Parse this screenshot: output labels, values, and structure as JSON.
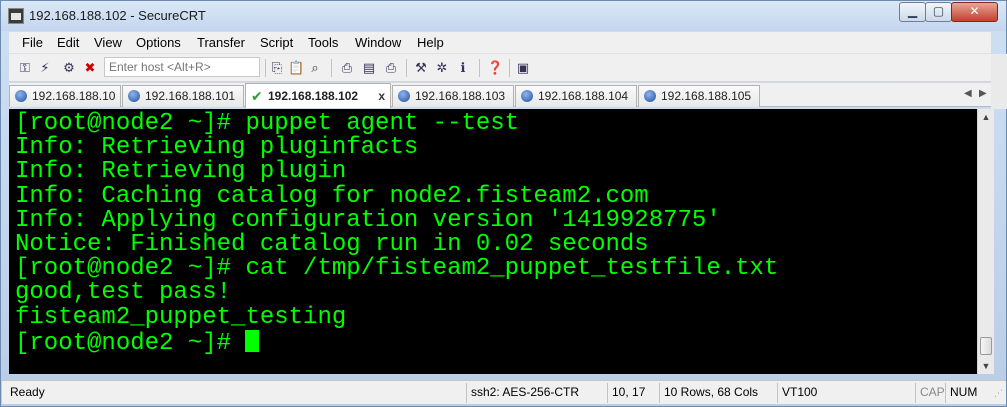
{
  "window": {
    "title": "192.168.188.102 - SecureCRT",
    "controls": {
      "minimize": "▁",
      "maximize": "▢",
      "close": "✕"
    }
  },
  "menubar": {
    "items": [
      "File",
      "Edit",
      "View",
      "Options",
      "Transfer",
      "Script",
      "Tools",
      "Window",
      "Help"
    ]
  },
  "toolbar": {
    "host_placeholder": "Enter host <Alt+R>",
    "icons": [
      "connect-icon",
      "quick-connect-icon",
      "connect-in-tab-icon",
      "disconnect-icon",
      "copy-icon",
      "paste-icon",
      "find-icon",
      "print-icon",
      "print-selection-icon",
      "printer-icon",
      "session-options-icon",
      "global-options-icon",
      "keymap-icon",
      "help-icon",
      "sftp-icon"
    ]
  },
  "tabs": {
    "items": [
      {
        "label": "192.168.188.10",
        "active": false
      },
      {
        "label": "192.168.188.101",
        "active": false
      },
      {
        "label": "192.168.188.102",
        "active": true,
        "close": "x"
      },
      {
        "label": "192.168.188.103",
        "active": false
      },
      {
        "label": "192.168.188.104",
        "active": false
      },
      {
        "label": "192.168.188.105",
        "active": false
      }
    ],
    "nav_left": "◀",
    "nav_right": "▶"
  },
  "terminal": {
    "fg_color": "#00ff00",
    "bg_color": "#000000",
    "lines": [
      "[root@node2 ~]# puppet agent --test",
      "Info: Retrieving pluginfacts",
      "Info: Retrieving plugin",
      "Info: Caching catalog for node2.fisteam2.com",
      "Info: Applying configuration version '1419928775'",
      "Notice: Finished catalog run in 0.02 seconds",
      "[root@node2 ~]# cat /tmp/fisteam2_puppet_testfile.txt",
      "good,test pass!",
      "fisteam2_puppet_testing"
    ],
    "prompt": "[root@node2 ~]# "
  },
  "statusbar": {
    "ready": "Ready",
    "protocol": "ssh2: AES-256-CTR",
    "position": "10,  17",
    "size": "10 Rows, 68 Cols",
    "emulation": "VT100",
    "caps": "CAP",
    "num": "NUM"
  }
}
